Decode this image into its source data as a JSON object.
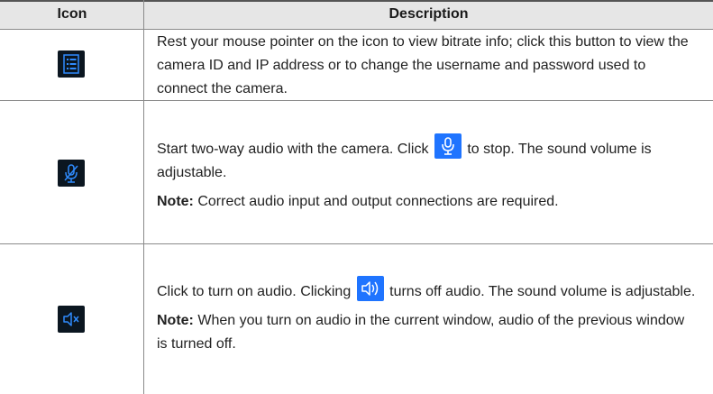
{
  "table": {
    "headers": {
      "icon": "Icon",
      "description": "Description"
    },
    "rows": [
      {
        "icon": "bitrate-info-icon",
        "text": "Rest your mouse pointer on the icon to view bitrate info; click this button to view the camera ID and IP address or to change the username and password used to connect the camera."
      },
      {
        "icon": "microphone-muted-icon",
        "text_before": "Start two-way audio with the camera. Click",
        "inline_icon": "microphone-icon",
        "text_after": "to stop. The sound volume is adjustable.",
        "note_label": "Note:",
        "note_text": "Correct audio input and output connections are required."
      },
      {
        "icon": "speaker-muted-icon",
        "text_before": "Click to turn on audio. Clicking",
        "inline_icon": "speaker-on-icon",
        "text_after": "turns off audio. The sound volume is adjustable.",
        "note_label": "Note:",
        "note_text": "When you turn on audio in the current window, audio of the previous window is turned off."
      }
    ]
  },
  "colors": {
    "header_bg": "#e6e6e6",
    "icon_tile_bg": "#0b1620",
    "icon_accent": "#2f8cff",
    "inline_icon_bg": "#1f74ff"
  }
}
